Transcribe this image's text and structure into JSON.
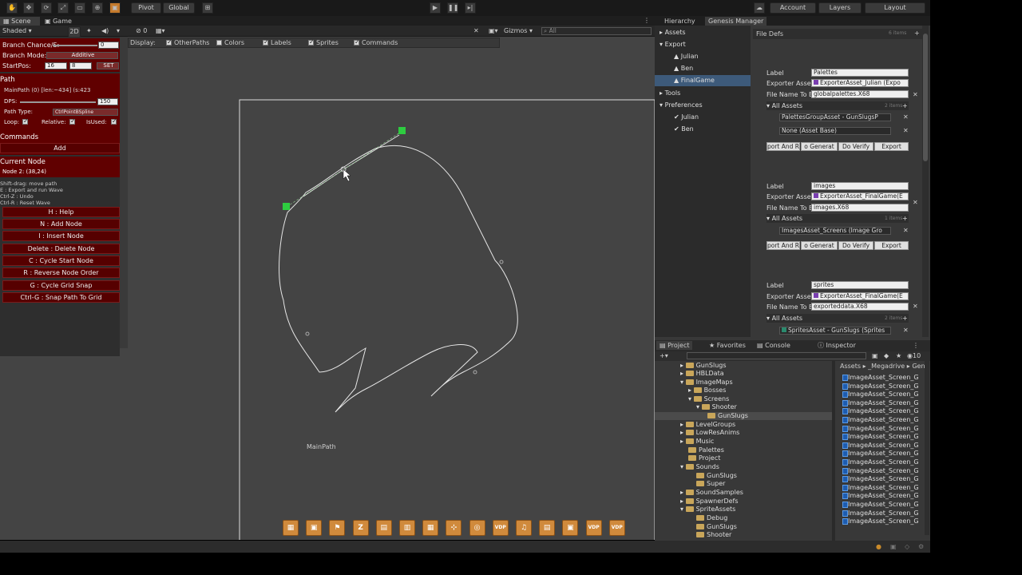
{
  "toolbar": {
    "pivot": "Pivot",
    "global": "Global",
    "account": "Account",
    "layers": "Layers",
    "layout": "Layout"
  },
  "scene_tabs": {
    "scene": "Scene",
    "game": "Game"
  },
  "scene_bar": {
    "shading": "Shaded",
    "mode_2d": "2D",
    "gizmos": "Gizmos",
    "search_placeholder": "All",
    "layer_count": "0"
  },
  "display": {
    "label": "Display:",
    "items": [
      "OtherPaths",
      "Colors",
      "Labels",
      "Sprites",
      "Commands"
    ],
    "checked": [
      true,
      false,
      true,
      true,
      true
    ]
  },
  "left": {
    "branch_chance": "Branch Chance/S:",
    "branch_chance_val": "0",
    "branch_mode": "Branch Mode:",
    "branch_mode_val": "Additive",
    "start_pos": "StartPos:",
    "start_x": "16",
    "start_y": "8",
    "set": "SET",
    "path_hdr": "Path",
    "main_path": "MainPath (0) [len:~434] (s:423",
    "dps": "DPS:",
    "dps_val": "150",
    "path_type": "Path Type:",
    "path_type_val": "CtrlPointBSpline",
    "loop": "Loop:",
    "relative": "Relative:",
    "isused": "IsUsed:",
    "commands_hdr": "Commands",
    "add": "Add",
    "current_node_hdr": "Current Node",
    "node_info": "Node 2: (38,24)",
    "help_lines": [
      "Shift-drag: move path",
      "E : Export and run Wave",
      "Ctrl-Z : Undo",
      "Ctrl-R : Reset Wave"
    ],
    "buttons": [
      "H : Help",
      "N : Add Node",
      "I : Insert Node",
      "Delete : Delete Node",
      "C : Cycle Start Node",
      "R : Reverse Node Order",
      "G : Cycle Grid Snap",
      "Ctrl-G : Snap Path To Grid"
    ]
  },
  "viewport": {
    "path_label": "MainPath"
  },
  "hierarchy": {
    "tab": "Hierarchy",
    "items": [
      "Assets",
      "Export",
      "Julian",
      "Ben",
      "FinalGame",
      "Tools",
      "Preferences",
      "Julian",
      "Ben"
    ]
  },
  "genesis": {
    "tab": "Genesis Manager",
    "file_defs": "File Defs",
    "item_count": "6 items",
    "label": "Label",
    "exporter": "Exporter Asset",
    "filename": "File Name To E",
    "all_assets": "All Assets",
    "export_btn": "Export",
    "verify_btn": "Do Verify",
    "gen_btn": "o Generat",
    "import_btn": "port And R",
    "entries": [
      {
        "label": "Palettes",
        "exporter": "ExporterAsset_Julian (Expo",
        "file": "globalpalettes.X68",
        "count": "2 items",
        "assets": [
          "PalettesGroupAsset - GunSlugsP",
          "None (Asset Base)"
        ]
      },
      {
        "label": "images",
        "exporter": "ExporterAsset_FinalGame(E",
        "file": "images.X68",
        "count": "1 items",
        "assets": [
          "ImagesAsset_Screens (Image Gro"
        ]
      },
      {
        "label": "sprites",
        "exporter": "ExporterAsset_FinalGame(E",
        "file": "exporteddata.X68",
        "count": "2 items",
        "assets": [
          "SpritesAsset - GunSlugs (Sprites"
        ]
      }
    ]
  },
  "bottom": {
    "tabs": [
      "Project",
      "Favorites",
      "Console",
      "Inspector"
    ],
    "count": "10",
    "breadcrumb": [
      "Assets",
      "_Megadrive",
      "Gen"
    ],
    "tree": [
      "GunSlugs",
      "HBLData",
      "ImageMaps",
      "Bosses",
      "Screens",
      "Shooter",
      "GunSlugs",
      "LevelGroups",
      "LowResAnims",
      "Music",
      "Palettes",
      "Project",
      "Sounds",
      "GunSlugs",
      "Super",
      "SoundSamples",
      "SpawnerDefs",
      "SpriteAssets",
      "Debug",
      "GunSlugs",
      "Shooter"
    ],
    "asset_name": "ImageAsset_Screen_G",
    "asset_rows": 18
  },
  "tool_icons": [
    "grid",
    "box",
    "flag",
    "Z",
    "layers",
    "doc",
    "grid2",
    "chart",
    "globe",
    "VDP",
    "music",
    "page",
    "box2",
    "VDP",
    "VDP"
  ]
}
